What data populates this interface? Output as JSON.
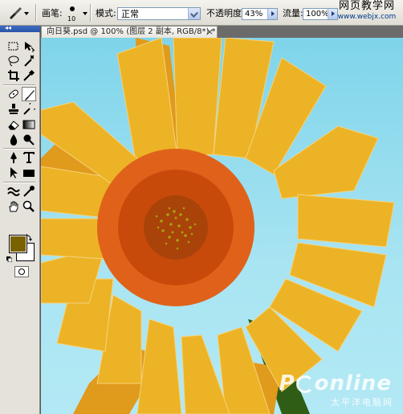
{
  "options_bar": {
    "tool_preset_icon": "brush-icon",
    "brush_label": "画笔:",
    "brush_size": "10",
    "mode_label": "模式:",
    "mode_value": "正常",
    "opacity_label": "不透明度:",
    "opacity_value": "43%",
    "flow_label": "流量:",
    "flow_value": "100%"
  },
  "site_watermark": {
    "name": "网页教学网",
    "url": "www.webjx.com"
  },
  "document": {
    "tab_title": "向日葵.psd @ 100% (图层 2 副本, RGB/8*) *",
    "close_glyph": "×"
  },
  "toolbox": {
    "grip_glyph": "◂◂",
    "foreground_color": "#7a6200",
    "background_color": "#ffffff",
    "tools": [
      "marquee-tool-icon",
      "move-tool-icon",
      "lasso-tool-icon",
      "magic-wand-tool-icon",
      "crop-tool-icon",
      "eyedropper-tool-icon",
      "healing-brush-tool-icon",
      "brush-tool-icon",
      "clone-stamp-tool-icon",
      "history-brush-tool-icon",
      "eraser-tool-icon",
      "gradient-tool-icon",
      "blur-tool-icon",
      "dodge-tool-icon",
      "pen-tool-icon",
      "type-tool-icon",
      "path-selection-tool-icon",
      "rectangle-tool-icon",
      "notes-tool-icon",
      "eyedropper-sample-icon",
      "hand-tool-icon",
      "zoom-tool-icon"
    ],
    "active_tool": "brush-tool-icon"
  },
  "canvas_watermark": {
    "brand": "PConline",
    "brand_prefix": "P",
    "brand_suffix": "online",
    "sub": "太平洋电脑网"
  },
  "colors": {
    "sky": "#8fd9ee",
    "petal": "#ecb326",
    "petal_dark": "#e09a1c",
    "disk_outer": "#e0621a",
    "disk_mid": "#c84a0b",
    "disk_center": "#a94309",
    "seed_dots": "#a8a012",
    "stem": "#2f5d16"
  }
}
